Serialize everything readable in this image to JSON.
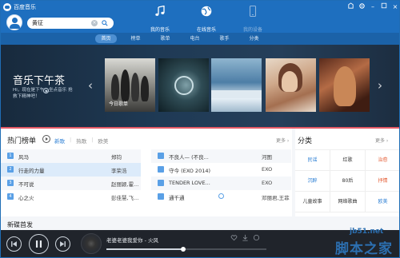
{
  "app": {
    "title": "百度音乐"
  },
  "search": {
    "value": "黄征",
    "placeholder": ""
  },
  "top_nav": [
    {
      "label": "我的音乐",
      "icon": "music-note-icon"
    },
    {
      "label": "在线音乐",
      "icon": "globe-icon"
    },
    {
      "label": "我的设备",
      "icon": "device-icon"
    }
  ],
  "sub_nav": [
    "首页",
    "榜单",
    "歌单",
    "电台",
    "歌手",
    "分类"
  ],
  "banner": {
    "title": "音乐下午茶",
    "subtitle": "Hi，现在是下午，坐点音乐 抢救下精神吧！",
    "cards": [
      {
        "label": "今日歌单",
        "tag": ""
      },
      {
        "label": "",
        "tag": ""
      },
      {
        "label": "",
        "tag": ""
      },
      {
        "label": "",
        "tag": ""
      },
      {
        "label": "",
        "tag": ""
      }
    ]
  },
  "hot_chart": {
    "title": "热门榜单",
    "tabs": [
      "新歌",
      "热歌",
      "欧美"
    ],
    "more": "更多 ›",
    "left_rows": [
      {
        "rank": "1",
        "song": "风马",
        "artist": "郑钧"
      },
      {
        "rank": "2",
        "song": "行走的力量",
        "artist": "李荣浩"
      },
      {
        "rank": "3",
        "song": "不可说",
        "artist": "赵丽颖,霍..."
      },
      {
        "rank": "4",
        "song": "心之火",
        "artist": "彭佳慧,飞..."
      }
    ],
    "right_rows": [
      {
        "rank": "",
        "song": "不良人— (不良...",
        "artist": "河图"
      },
      {
        "rank": "",
        "song": "守今 (EXO 2014)",
        "artist": "EXO"
      },
      {
        "rank": "",
        "song": "TENDER LOVE...",
        "artist": "EXO"
      },
      {
        "rank": "",
        "song": "通千通",
        "artist": "邓丽君,王菲"
      }
    ]
  },
  "categories": {
    "title": "分类",
    "more": "更多 ›",
    "items": [
      {
        "label": "民谣",
        "color": "#2c7fd4"
      },
      {
        "label": "红歌",
        "color": "#333333"
      },
      {
        "label": "治愈",
        "color": "#e4572e"
      },
      {
        "label": "沉醉",
        "color": "#2c7fd4"
      },
      {
        "label": "80后",
        "color": "#333333"
      },
      {
        "label": "抒情",
        "color": "#e4572e"
      },
      {
        "label": "儿童故事",
        "color": "#333333"
      },
      {
        "label": "网络歌曲",
        "color": "#333333"
      },
      {
        "label": "欧美",
        "color": "#2c7fd4"
      }
    ]
  },
  "new_release": {
    "title": "新碟首发"
  },
  "player": {
    "now_playing": "老婆老婆我爱你 - 火风",
    "progress": 0.48
  },
  "watermark": {
    "url": "jb51.net",
    "name": "脚本之家"
  }
}
